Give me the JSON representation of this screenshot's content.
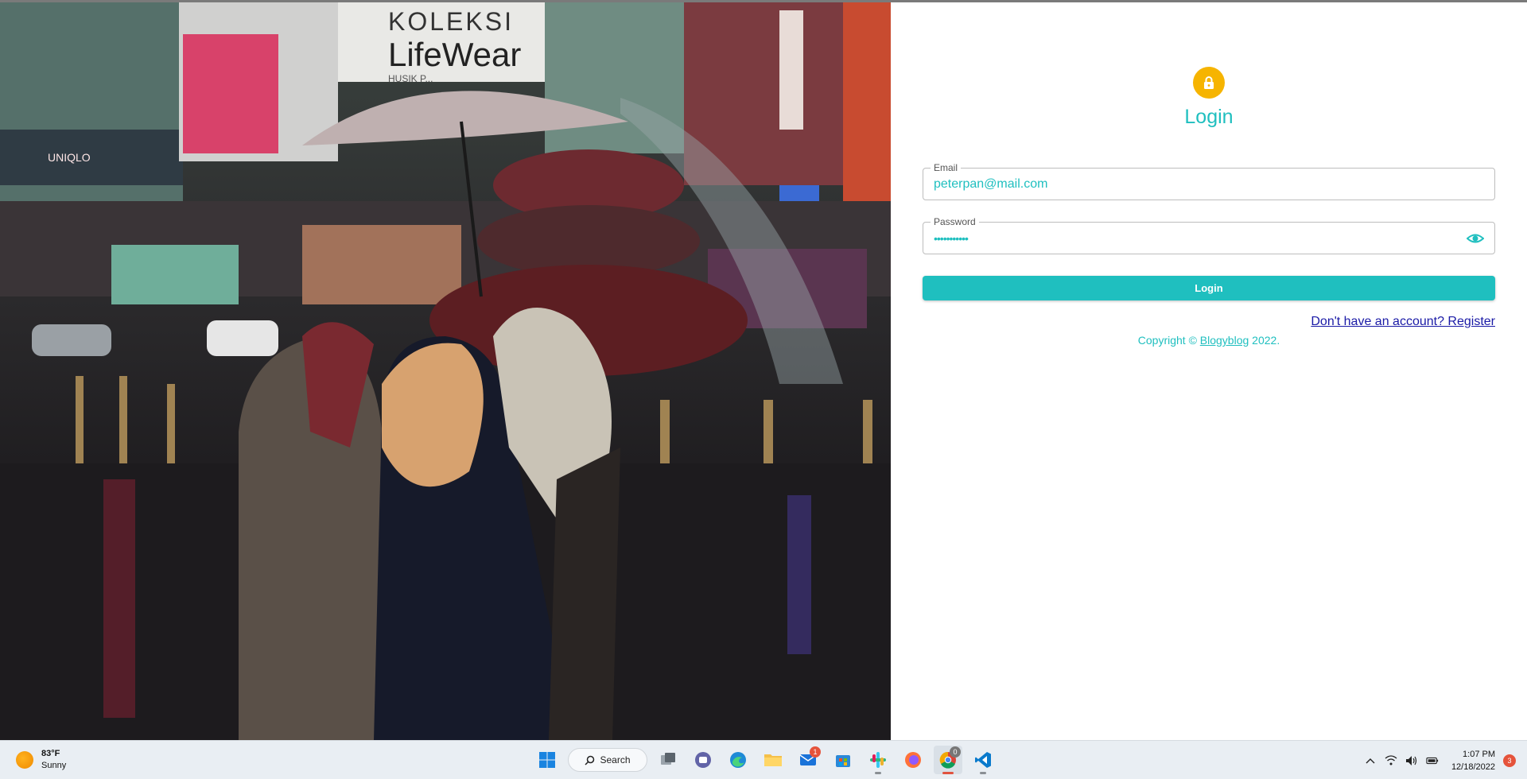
{
  "login": {
    "title": "Login",
    "email_label": "Email",
    "email_value": "peterpan@mail.com",
    "password_label": "Password",
    "password_value": "•••••••••••",
    "button_label": "Login",
    "register_link": "Don't have an account? Register",
    "copyright_prefix": "Copyright © ",
    "copyright_brand": "Blogyblog",
    "copyright_suffix": " 2022."
  },
  "photo": {
    "sign_top": "KOLEKSI",
    "sign_main": "LifeWear",
    "sign_small": "HUSIK P...",
    "store_sign": "UNIQLO"
  },
  "colors": {
    "accent": "#1fbfbf",
    "lock": "#f6b400",
    "link": "#1a1aa6"
  },
  "taskbar": {
    "weather_temp": "83°F",
    "weather_desc": "Sunny",
    "search_label": "Search",
    "mail_badge": "1",
    "chrome_badge": "0",
    "time": "1:07 PM",
    "date": "12/18/2022",
    "notif_count": "3",
    "icons": [
      "windows-start-icon",
      "search-icon",
      "task-view-icon",
      "teams-icon",
      "edge-icon",
      "file-explorer-icon",
      "mail-icon",
      "store-icon",
      "slack-icon",
      "firefox-icon",
      "chrome-icon",
      "vscode-icon"
    ]
  }
}
